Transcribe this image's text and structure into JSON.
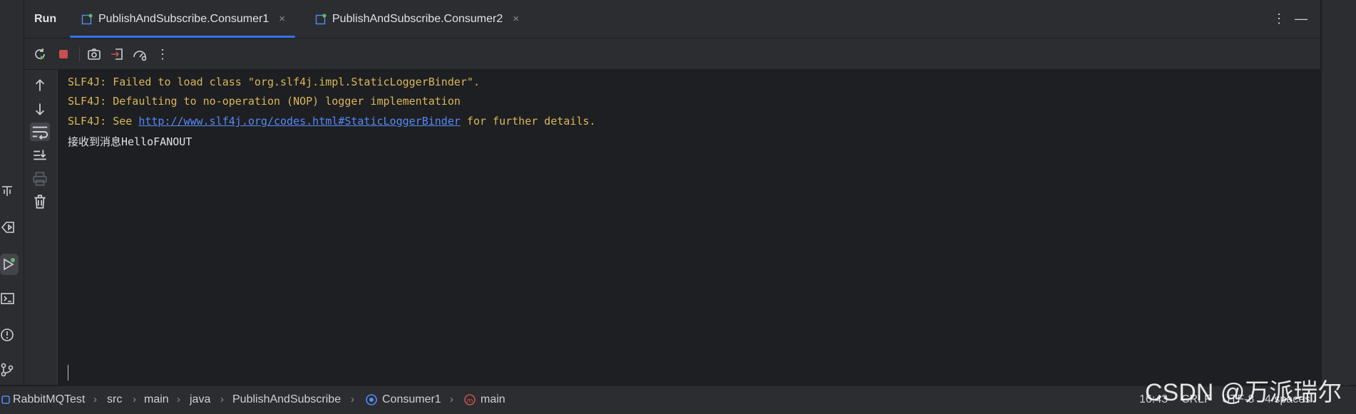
{
  "run_window": {
    "title": "Run",
    "tabs": [
      {
        "label": "PublishAndSubscribe.Consumer1",
        "close": "×",
        "icon": "run-config-icon"
      },
      {
        "label": "PublishAndSubscribe.Consumer2",
        "close": "×",
        "icon": "run-config-icon"
      }
    ],
    "more_glyph": "⋮",
    "minimize_glyph": "—"
  },
  "toolbar": {
    "icons": [
      "rerun-icon",
      "stop-icon",
      "screenshot-icon",
      "exit-icon",
      "profiler-icon",
      "more-icon"
    ],
    "more_glyph": "⋮"
  },
  "side_actions": [
    "up-arrow-icon",
    "down-arrow-icon",
    "soft-wrap-icon",
    "scroll-to-end-icon",
    "print-icon",
    "trash-icon"
  ],
  "console": {
    "line1": "SLF4J: Failed to load class \"org.slf4j.impl.StaticLoggerBinder\".",
    "line2": "SLF4J: Defaulting to no-operation (NOP) logger implementation",
    "line3_prefix": "SLF4J: See ",
    "line3_link": "http://www.slf4j.org/codes.html#StaticLoggerBinder",
    "line3_suffix": " for further details.",
    "line4": "接收到消息HelloFANOUT"
  },
  "statusbar": {
    "breadcrumbs": [
      "RabbitMQTest",
      "src",
      "main",
      "java",
      "PublishAndSubscribe",
      "Consumer1",
      "main"
    ],
    "position": "16:43",
    "line_ending": "CRLF",
    "encoding": "UTF-8",
    "indent": "4 spaces"
  },
  "watermark": "CSDN @万派瑞尔",
  "colors": {
    "accent": "#3574f0",
    "stderr": "#d9b658",
    "link": "#548af7",
    "stop": "#c94f4f",
    "status_green": "#5fb865"
  }
}
